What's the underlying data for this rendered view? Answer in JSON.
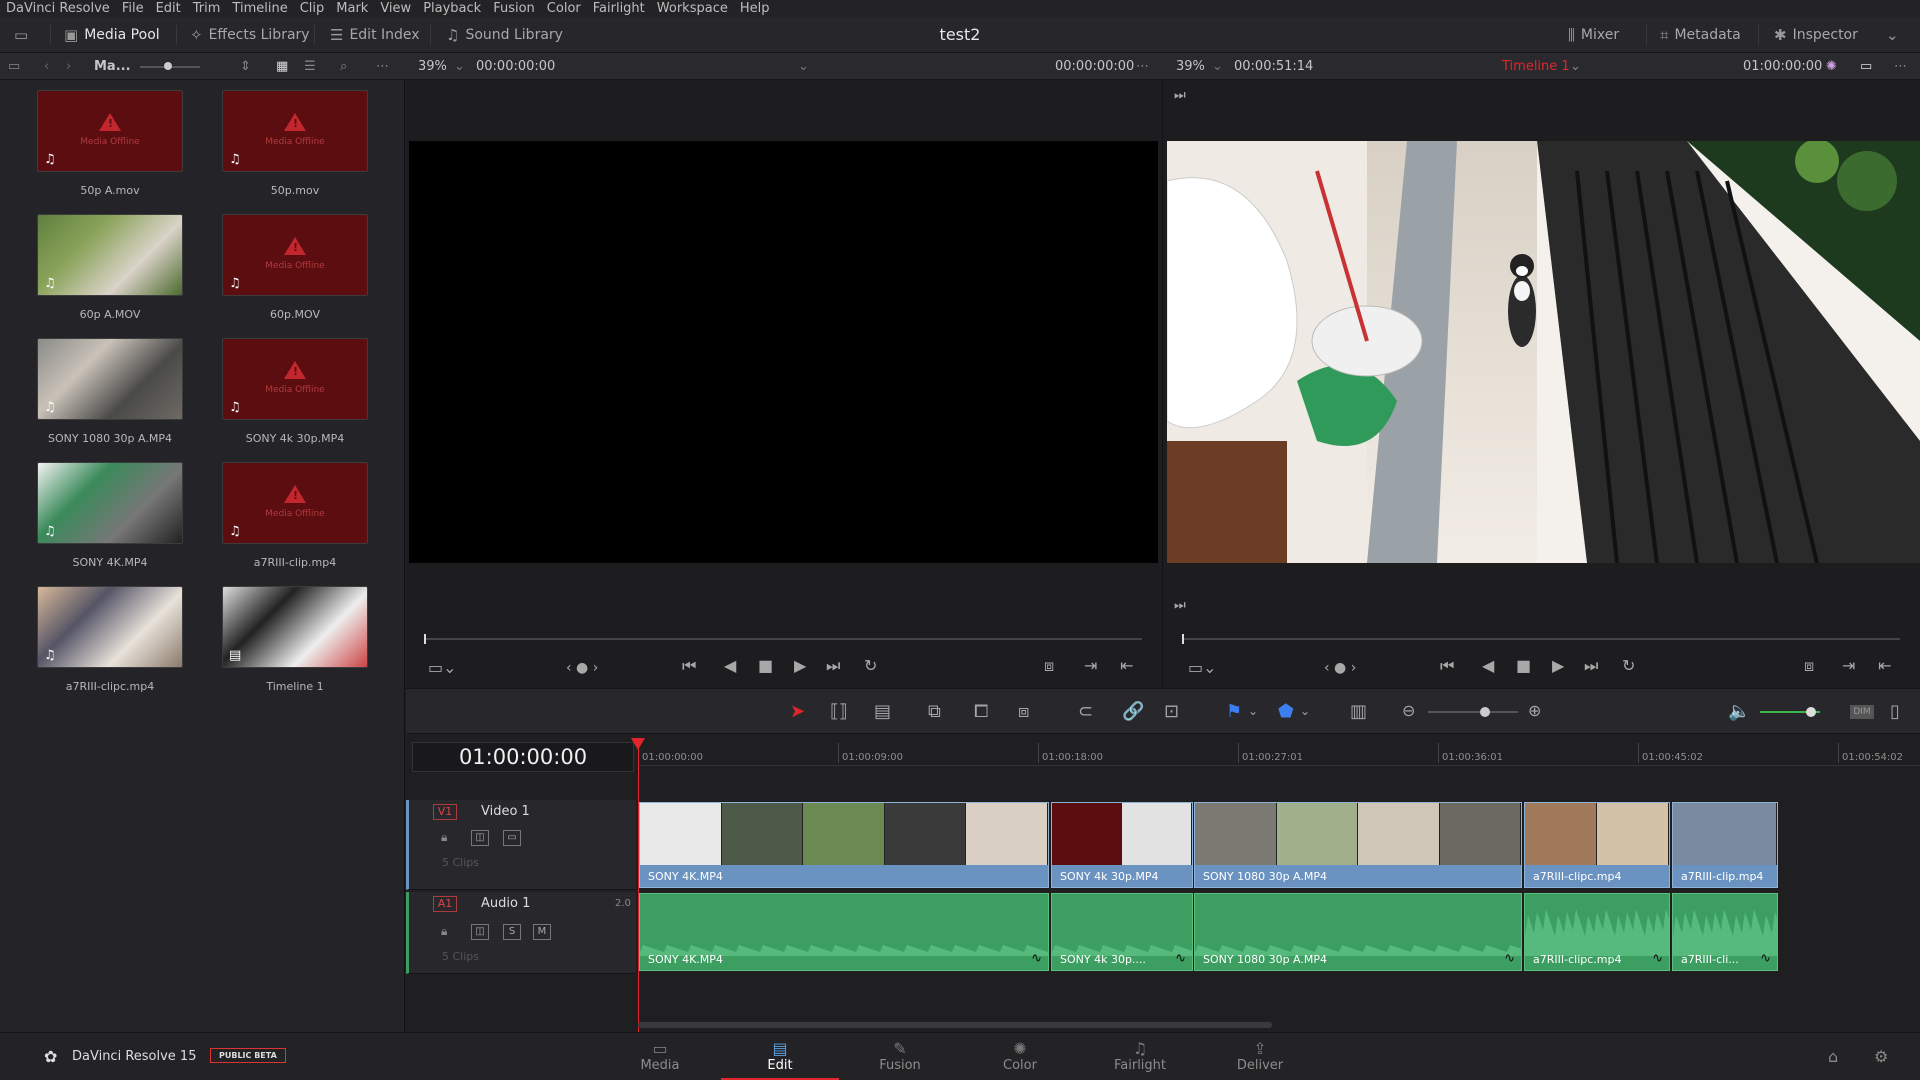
{
  "menu": [
    "DaVinci Resolve",
    "File",
    "Edit",
    "Trim",
    "Timeline",
    "Clip",
    "Mark",
    "View",
    "Playback",
    "Fusion",
    "Color",
    "Fairlight",
    "Workspace",
    "Help"
  ],
  "toolbar": {
    "media_pool": "Media Pool",
    "effects_library": "Effects Library",
    "edit_index": "Edit Index",
    "sound_library": "Sound Library",
    "project_title": "test2",
    "mixer": "Mixer",
    "metadata": "Metadata",
    "inspector": "Inspector"
  },
  "subbar": {
    "bin_name": "Ma...",
    "source_zoom": "39%",
    "source_tc": "00:00:00:00",
    "source_duration": "00:00:00:00",
    "timeline_zoom": "39%",
    "timeline_duration": "00:00:51:14",
    "timeline_name": "Timeline 1",
    "timeline_tc": "01:00:00:00"
  },
  "media_pool": {
    "offline_text": "Media Offline",
    "clips": [
      {
        "name": "50p A.mov",
        "offline": true
      },
      {
        "name": "50p.mov",
        "offline": true
      },
      {
        "name": "60p A.MOV",
        "offline": false
      },
      {
        "name": "60p.MOV",
        "offline": true
      },
      {
        "name": "SONY 1080 30p A.MP4",
        "offline": false
      },
      {
        "name": "SONY 4k 30p.MP4",
        "offline": true
      },
      {
        "name": "SONY 4K.MP4",
        "offline": false
      },
      {
        "name": "a7RIII-clip.mp4",
        "offline": true
      },
      {
        "name": "a7RIII-clipc.mp4",
        "offline": false
      },
      {
        "name": "Timeline 1",
        "offline": false
      }
    ]
  },
  "timeline": {
    "timecode": "01:00:00:00",
    "ruler": [
      "01:00:00:00",
      "01:00:09:00",
      "01:00:18:00",
      "01:00:27:01",
      "01:00:36:01",
      "01:00:45:02",
      "01:00:54:02"
    ],
    "video_track": {
      "tag": "V1",
      "name": "Video 1",
      "count": "5 Clips"
    },
    "audio_track": {
      "tag": "A1",
      "name": "Audio 1",
      "channels": "2.0",
      "count": "5 Clips",
      "solo": "S",
      "mute": "M"
    },
    "video_clips": [
      "SONY 4K.MP4",
      "SONY 4k 30p.MP4",
      "SONY 1080 30p A.MP4",
      "a7RIII-clipc.mp4",
      "a7RIII-clip.mp4"
    ],
    "audio_clips": [
      "SONY 4K.MP4",
      "SONY 4k 30p....",
      "SONY 1080 30p A.MP4",
      "a7RIII-clipc.mp4",
      "a7RIII-cli..."
    ]
  },
  "edit_toolbar": {
    "dim": "DIM"
  },
  "pagebar": {
    "app": "DaVinci Resolve 15",
    "badge": "PUBLIC BETA",
    "pages": [
      "Media",
      "Edit",
      "Fusion",
      "Color",
      "Fairlight",
      "Deliver"
    ],
    "active": "Edit"
  },
  "colors": {
    "accent_red": "#e0262c",
    "video_clip": "#6b93c1",
    "audio_clip": "#3d9e62",
    "offline": "#5c0d10"
  }
}
